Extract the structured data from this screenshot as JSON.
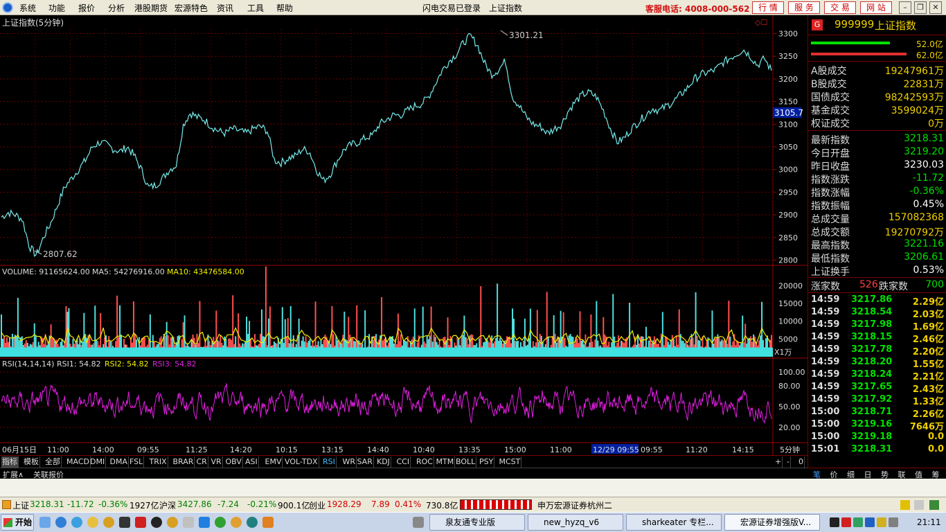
{
  "menu": {
    "items": [
      "系统",
      "功能",
      "报价",
      "分析",
      "港股期货",
      "宏源特色",
      "资讯",
      "工具",
      "帮助"
    ],
    "login_status": "闪电交易已登录",
    "current_index": "上证指数",
    "hotline": "客服电话: 4008-000-562",
    "nav_buttons": [
      "行 情",
      "服 务",
      "交 易",
      "网 站"
    ]
  },
  "chart": {
    "title": "上证指数(5分钟)",
    "price_ticks": [
      "3300",
      "3250",
      "3200",
      "3150",
      "3100",
      "3050",
      "3000",
      "2950",
      "2900",
      "2850",
      "2800"
    ],
    "high_label": "3301.21",
    "low_label": "2807.62",
    "current_marker": "3105.7",
    "volume_header": {
      "volume": "VOLUME: 91165624.00",
      "ma5": "MA5: 54276916.00",
      "ma10": "MA10: 43476584.00"
    },
    "volume_ticks": [
      "20000",
      "15000",
      "10000",
      "5000"
    ],
    "volume_unit": "X1万",
    "rsi_header": {
      "params": "RSI(14,14,14)",
      "rsi1": "RSI1: 54.82",
      "rsi2": "RSI2: 54.82",
      "rsi3": "RSI3: 54.82"
    },
    "rsi_ticks": [
      "100.00",
      "80.00",
      "50.00",
      "20.00"
    ],
    "time_labels": [
      "06月15日",
      "11:00",
      "14:00",
      "09:55",
      "11:25",
      "14:20",
      "10:15",
      "13:15",
      "14:40",
      "10:40",
      "13:35",
      "15:00",
      "11:00",
      "12/29 09:55",
      "09:55",
      "11:20",
      "14:15"
    ],
    "period": "5分钟"
  },
  "chart_data": {
    "type": "line",
    "series": [
      {
        "name": "上证指数",
        "values": [
          2895,
          2905,
          2900,
          2890,
          2830,
          2810,
          2850,
          2880,
          2920,
          2960,
          2980,
          3000,
          3020,
          3050,
          3060,
          3055,
          3045,
          3040,
          3050,
          3030,
          3000,
          2960,
          2965,
          2980,
          3000,
          3010,
          3100,
          3125,
          3115,
          3110,
          3095,
          3085,
          3080,
          3090,
          3085,
          3080,
          3090,
          3095,
          3085,
          3020,
          3015,
          3025,
          3030,
          3045,
          3040,
          3000,
          2975,
          2990,
          3020,
          3045,
          3055,
          3060,
          3070,
          3075,
          3100,
          3110,
          3120,
          3120,
          3130,
          3140,
          3145,
          3160,
          3190,
          3220,
          3240,
          3255,
          3280,
          3295,
          3275,
          3235,
          3210,
          3220,
          3240,
          3160,
          3140,
          3115,
          3100,
          3095,
          3080,
          3090,
          3100,
          3130,
          3150,
          3165,
          3170,
          3160,
          3130,
          3090,
          3060,
          3070,
          3090,
          3105,
          3120,
          3135,
          3130,
          3140,
          3150,
          3165,
          3180,
          3200,
          3210,
          3215,
          3220,
          3235,
          3245,
          3255,
          3265,
          3250,
          3230,
          3245,
          3218
        ]
      }
    ],
    "ylim": [
      2790,
      3310
    ],
    "volume_ylim": [
      0,
      22000
    ],
    "rsi_ylim": [
      0,
      110
    ]
  },
  "quote": {
    "code": "999999",
    "name": "上证指数",
    "bar1": "52.0亿",
    "bar2": "62.0亿",
    "rows": [
      {
        "label": "A股成交",
        "value": "19247961万",
        "color": "#f0d000"
      },
      {
        "label": "B股成交",
        "value": "22831万",
        "color": "#f0d000"
      },
      {
        "label": "国债成交",
        "value": "98242593万",
        "color": "#f0d000"
      },
      {
        "label": "基金成交",
        "value": "3599024万",
        "color": "#f0d000"
      },
      {
        "label": "权证成交",
        "value": "0万",
        "color": "#f0d000"
      },
      {
        "label": "最新指数",
        "value": "3218.31",
        "color": "#00e000"
      },
      {
        "label": "今日开盘",
        "value": "3219.20",
        "color": "#00e000"
      },
      {
        "label": "昨日收盘",
        "value": "3230.03",
        "color": "#ffffff"
      },
      {
        "label": "指数涨跌",
        "value": "-11.72",
        "color": "#00e000"
      },
      {
        "label": "指数涨幅",
        "value": "-0.36%",
        "color": "#00e000"
      },
      {
        "label": "指数振幅",
        "value": "0.45%",
        "color": "#ffffff"
      },
      {
        "label": "总成交量",
        "value": "157082368",
        "color": "#f0d000"
      },
      {
        "label": "总成交额",
        "value": "19270792万",
        "color": "#f0d000"
      },
      {
        "label": "最高指数",
        "value": "3221.16",
        "color": "#00e000"
      },
      {
        "label": "最低指数",
        "value": "3206.61",
        "color": "#00e000"
      },
      {
        "label": "上证换手",
        "value": "0.53%",
        "color": "#ffffff"
      }
    ],
    "up_label": "涨家数",
    "up_count": "526",
    "down_label": "跌家数",
    "down_count": "700",
    "ticks": [
      {
        "time": "14:59",
        "price": "3217.86",
        "amount": "2.29亿"
      },
      {
        "time": "14:59",
        "price": "3218.54",
        "amount": "2.03亿"
      },
      {
        "time": "14:59",
        "price": "3217.98",
        "amount": "1.69亿"
      },
      {
        "time": "14:59",
        "price": "3218.15",
        "amount": "2.46亿"
      },
      {
        "time": "14:59",
        "price": "3217.78",
        "amount": "2.20亿"
      },
      {
        "time": "14:59",
        "price": "3218.20",
        "amount": "1.55亿"
      },
      {
        "time": "14:59",
        "price": "3218.24",
        "amount": "2.21亿"
      },
      {
        "time": "14:59",
        "price": "3217.65",
        "amount": "2.43亿"
      },
      {
        "time": "14:59",
        "price": "3217.92",
        "amount": "1.33亿"
      },
      {
        "time": "15:00",
        "price": "3218.71",
        "amount": "2.26亿"
      },
      {
        "time": "15:00",
        "price": "3219.16",
        "amount": "7646万"
      },
      {
        "time": "15:00",
        "price": "3219.18",
        "amount": "0.0"
      },
      {
        "time": "15:01",
        "price": "3218.31",
        "amount": "0.0"
      }
    ],
    "bottom_tabs": [
      "笔",
      "价",
      "细",
      "日",
      "势",
      "联",
      "值",
      "筹"
    ]
  },
  "indicator_tabs": [
    "指标",
    "模板",
    "全部",
    "MACD",
    "DMI",
    "DMA",
    "FSL",
    "TRIX",
    "BRAR",
    "CR",
    "VR",
    "OBV",
    "ASI",
    "EMV",
    "VOL-TDX",
    "RSI",
    "WR",
    "SAR",
    "KDJ",
    "CCI",
    "ROC",
    "MTM",
    "BOLL",
    "PSY",
    "MCST"
  ],
  "tab_controls": [
    "+",
    "-",
    "0"
  ],
  "ext_tabs": [
    "扩展∧",
    "关联报价"
  ],
  "status": {
    "sh_label": "上证",
    "sh_price": "3218.31",
    "sh_chg": "-11.72",
    "sh_pct": "-0.36%",
    "sh_amt": "1927亿",
    "hs_label": "沪深",
    "hs_price": "3427.86",
    "hs_chg": "-7.24",
    "hs_pct": "-0.21%",
    "hs_amt": "900.1亿",
    "cy_label": "创业",
    "cy_price": "1928.29",
    "cy_chg": "7.89",
    "cy_pct": "0.41%",
    "cy_amt": "730.8亿",
    "broker": "申万宏源证券杭州二"
  },
  "taskbar": {
    "start": "开始",
    "windows": [
      "泉友通专业版",
      "new_hyzq_v6",
      "sharkeater 专栏...",
      "宏源证券增强版V..."
    ],
    "clock": "21:11"
  }
}
